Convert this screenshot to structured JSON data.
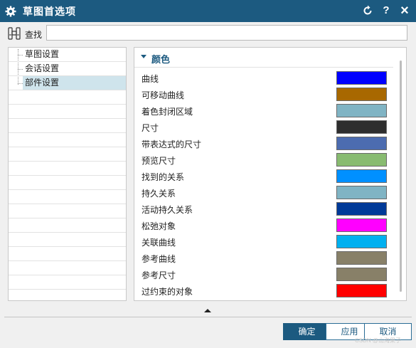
{
  "window": {
    "title": "草图首选项",
    "icons": [
      "gear-icon",
      "reset-icon",
      "help-icon",
      "close-icon"
    ],
    "help_glyph": "?",
    "close_glyph": "×"
  },
  "search": {
    "label": "查找",
    "value": "",
    "placeholder": ""
  },
  "tree": {
    "items": [
      {
        "label": "草图设置",
        "selected": false
      },
      {
        "label": "会话设置",
        "selected": false
      },
      {
        "label": "部件设置",
        "selected": true
      }
    ]
  },
  "colors_section": {
    "title": "颜色",
    "rows": [
      {
        "label": "曲线",
        "color": "#0000ff"
      },
      {
        "label": "可移动曲线",
        "color": "#a86800"
      },
      {
        "label": "着色封闭区域",
        "color": "#80b4c4"
      },
      {
        "label": "尺寸",
        "color": "#2e2e2e"
      },
      {
        "label": "带表达式的尺寸",
        "color": "#4c6cb0"
      },
      {
        "label": "预览尺寸",
        "color": "#88bb70"
      },
      {
        "label": "找到的关系",
        "color": "#0090ff"
      },
      {
        "label": "持久关系",
        "color": "#80b4c4"
      },
      {
        "label": "活动持久关系",
        "color": "#003a98"
      },
      {
        "label": "松弛对象",
        "color": "#ff00ff"
      },
      {
        "label": "关联曲线",
        "color": "#00b0f0"
      },
      {
        "label": "参考曲线",
        "color": "#888068"
      },
      {
        "label": "参考尺寸",
        "color": "#888068"
      },
      {
        "label": "过约束的对象",
        "color": "#ff0000"
      }
    ]
  },
  "buttons": {
    "ok": "确定",
    "apply": "应用",
    "cancel": "取消"
  },
  "watermark": "CSDN @山海果子"
}
